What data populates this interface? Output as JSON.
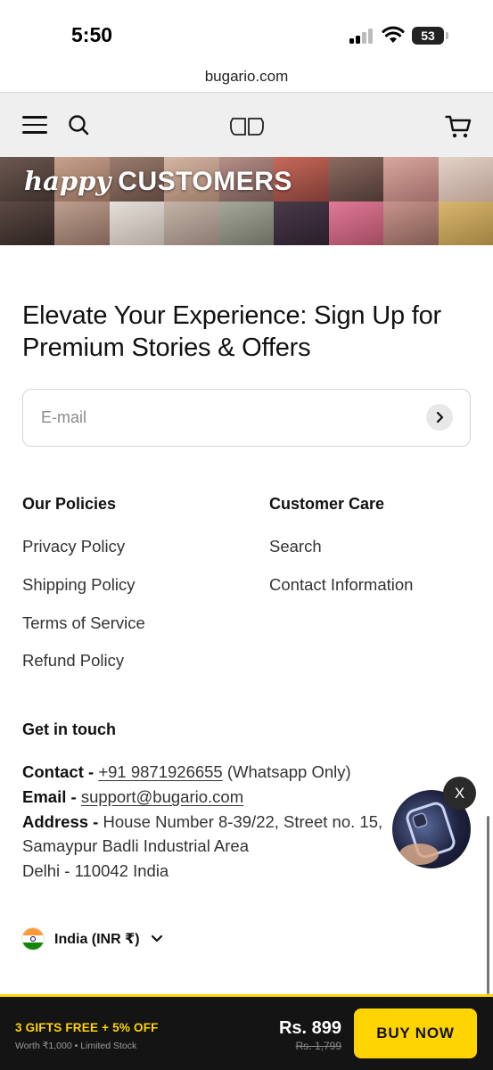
{
  "status_bar": {
    "time": "5:50",
    "battery": "53"
  },
  "browser": {
    "url": "bugario.com"
  },
  "header": {
    "logo_icon": "bugario-logo-icon",
    "menu_icon": "hamburger-icon",
    "search_icon": "search-icon",
    "cart_icon": "cart-icon"
  },
  "banner": {
    "script_text": "happy",
    "bold_text": "CUSTOMERS"
  },
  "signup": {
    "heading": "Elevate Your Experience: Sign Up for Premium Stories & Offers",
    "email_placeholder": "E-mail",
    "submit_icon": "arrow-right-icon"
  },
  "footer": {
    "policies": {
      "heading": "Our Policies",
      "links": [
        "Privacy Policy",
        "Shipping Policy",
        "Terms of Service",
        "Refund Policy"
      ]
    },
    "customer_care": {
      "heading": "Customer Care",
      "links": [
        "Search",
        "Contact Information"
      ]
    },
    "get_in_touch": {
      "heading": "Get in touch",
      "contact_label": "Contact -",
      "phone": "+91 9871926655",
      "phone_note": "(Whatsapp Only)",
      "email_label": "Email -",
      "email": "support@bugario.com",
      "address_label": "Address -",
      "address_line1": "House Number 8-39/22, Street no. 15,",
      "address_line2": "Samaypur Badli Industrial Area",
      "address_line3": "Delhi - 110042 India"
    },
    "country": {
      "label": "India (INR ₹)",
      "flag_icon": "india-flag-icon"
    }
  },
  "video_popup": {
    "close_label": "X"
  },
  "buy_bar": {
    "promo": "3 GIFTS FREE + 5% OFF",
    "promo_sub": "Worth ₹1,000 • Limited Stock",
    "price": "Rs. 899",
    "compare_price": "Rs. 1,799",
    "button": "BUY NOW"
  },
  "colors": {
    "accent": "#ffd400",
    "bar_bg": "#141414",
    "header_bg": "#efefef"
  }
}
